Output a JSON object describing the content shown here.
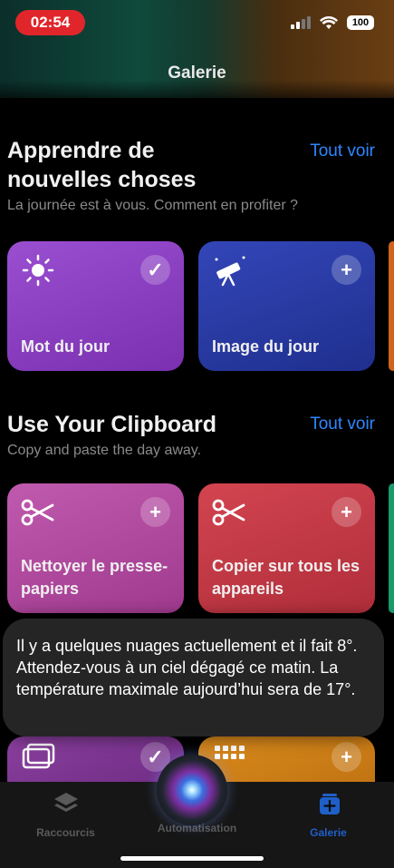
{
  "status_bar": {
    "time": "02:54",
    "battery": "100"
  },
  "nav": {
    "title": "Galerie"
  },
  "sections": [
    {
      "title": "Apprendre de nouvelles choses",
      "link": "Tout voir",
      "subtitle": "La journée est à vous. Comment en profiter ?",
      "cards": [
        {
          "label": "Mot du jour",
          "icon": "sun-icon",
          "badge": "check",
          "color": "#8a3fc0"
        },
        {
          "label": "Image du jour",
          "icon": "telescope-icon",
          "badge": "plus",
          "color": "#2a3ea0"
        }
      ]
    },
    {
      "title": "Use Your Clipboard",
      "link": "Tout voir",
      "subtitle": "Copy and paste the day away.",
      "cards": [
        {
          "label": "Nettoyer le presse-papiers",
          "icon": "scissors-icon",
          "badge": "plus",
          "color": "#b0459a"
        },
        {
          "label": "Copier sur tous les appareils",
          "icon": "scissors-icon",
          "badge": "plus",
          "color": "#c53c48"
        }
      ]
    }
  ],
  "siri": {
    "response": "Il y a quelques nuages actuellement et il fait 8°. Attendez-vous à un ciel dégagé ce matin. La température maximale aujourd’hui sera de 17°."
  },
  "tabs": [
    {
      "label": "Raccourcis",
      "icon": "layers-icon",
      "active": false
    },
    {
      "label": "Automatisation",
      "icon": "clock-icon",
      "active": false
    },
    {
      "label": "Galerie",
      "icon": "gallery-icon",
      "active": true
    }
  ],
  "colors": {
    "accent": "#2f86ff",
    "siri_bubble": "#262628"
  }
}
